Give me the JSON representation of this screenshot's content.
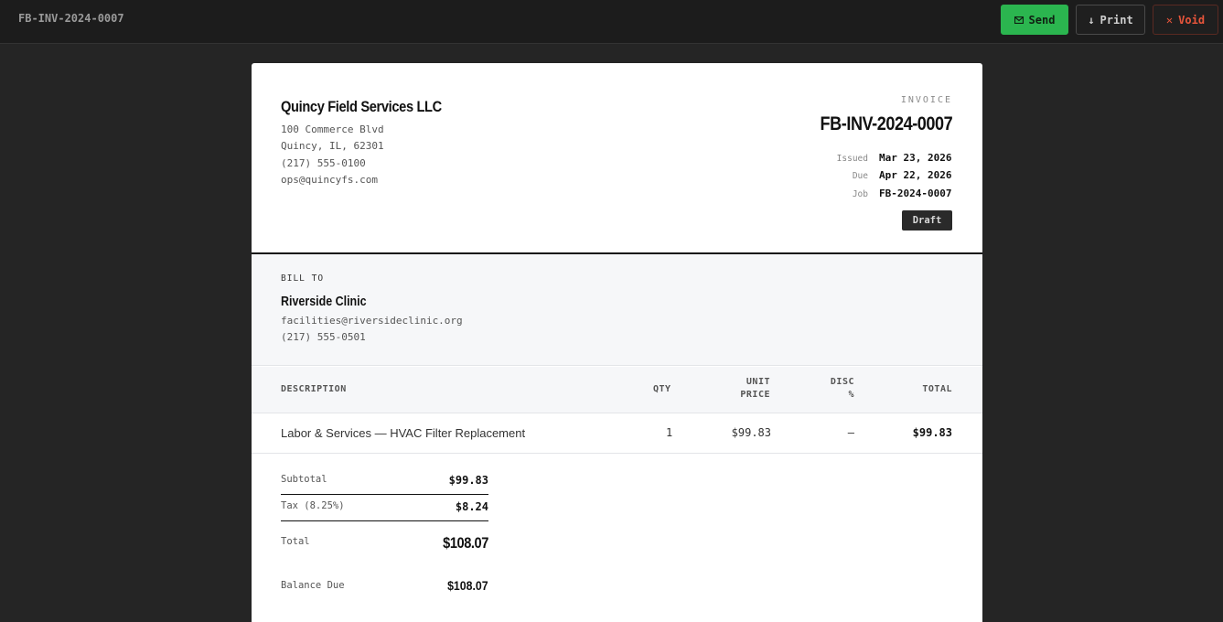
{
  "topbar": {
    "title": "FB-INV-2024-0007",
    "send_label": "Send",
    "send_icon": "mail-icon",
    "print_label": "Print",
    "print_icon": "↓",
    "void_label": "Void",
    "void_icon": "✕"
  },
  "company": {
    "name": "Quincy Field Services LLC",
    "address1": "100 Commerce Blvd",
    "address2": "Quincy, IL, 62301",
    "phone": "(217) 555-0100",
    "email": "ops@quincyfs.com"
  },
  "invoice": {
    "label": "INVOICE",
    "number": "FB-INV-2024-0007",
    "issued_label": "Issued",
    "issued": "Mar 23, 2026",
    "due_label": "Due",
    "due": "Apr 22, 2026",
    "job_label": "Job",
    "job": "FB-2024-0007",
    "status": "Draft"
  },
  "bill_to": {
    "label": "BILL TO",
    "name": "Riverside Clinic",
    "email": "facilities@riversideclinic.org",
    "phone": "(217) 555-0501"
  },
  "table": {
    "headers": {
      "description": "DESCRIPTION",
      "qty": "QTY",
      "unit_price_1": "UNIT",
      "unit_price_2": "PRICE",
      "disc_1": "DISC",
      "disc_2": "%",
      "total": "TOTAL"
    },
    "rows": [
      {
        "description": "Labor & Services — HVAC Filter Replacement",
        "qty": "1",
        "unit_price": "$99.83",
        "disc": "—",
        "total": "$99.83"
      }
    ]
  },
  "totals": {
    "subtotal_label": "Subtotal",
    "subtotal": "$99.83",
    "tax_label": "Tax (8.25%)",
    "tax": "$8.24",
    "total_label": "Total",
    "total": "$108.07",
    "balance_label": "Balance Due",
    "balance": "$108.07"
  },
  "colors": {
    "send": "#2bb54f",
    "void": "#e8553b",
    "background": "#252525"
  }
}
